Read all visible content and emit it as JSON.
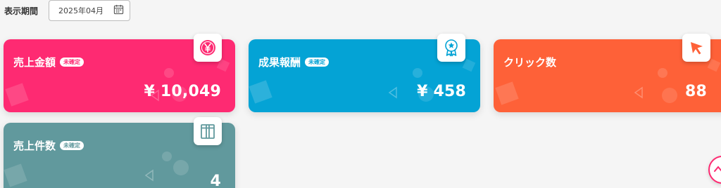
{
  "filter": {
    "label": "表示期間",
    "value": "2025年04月",
    "icon": "calendar-icon"
  },
  "cards": {
    "sales": {
      "title": "売上金額",
      "badge": "未確定",
      "value": "¥ 10,049",
      "icon": "yen-coin-icon",
      "color": "#fe2a72"
    },
    "reward": {
      "title": "成果報酬",
      "badge": "未確定",
      "value": "¥ 458",
      "icon": "award-ribbon-icon",
      "color": "#04a3d5"
    },
    "clicks": {
      "title": "クリック数",
      "value": "88",
      "icon": "cursor-arrow-icon",
      "color": "#fe6138"
    },
    "count": {
      "title": "売上件数",
      "badge": "未確定",
      "value": "4",
      "icon": "box-icon",
      "color": "#61999d"
    }
  },
  "scroll_top": {
    "icon": "chevron-up-icon",
    "color": "#fe2a72"
  }
}
